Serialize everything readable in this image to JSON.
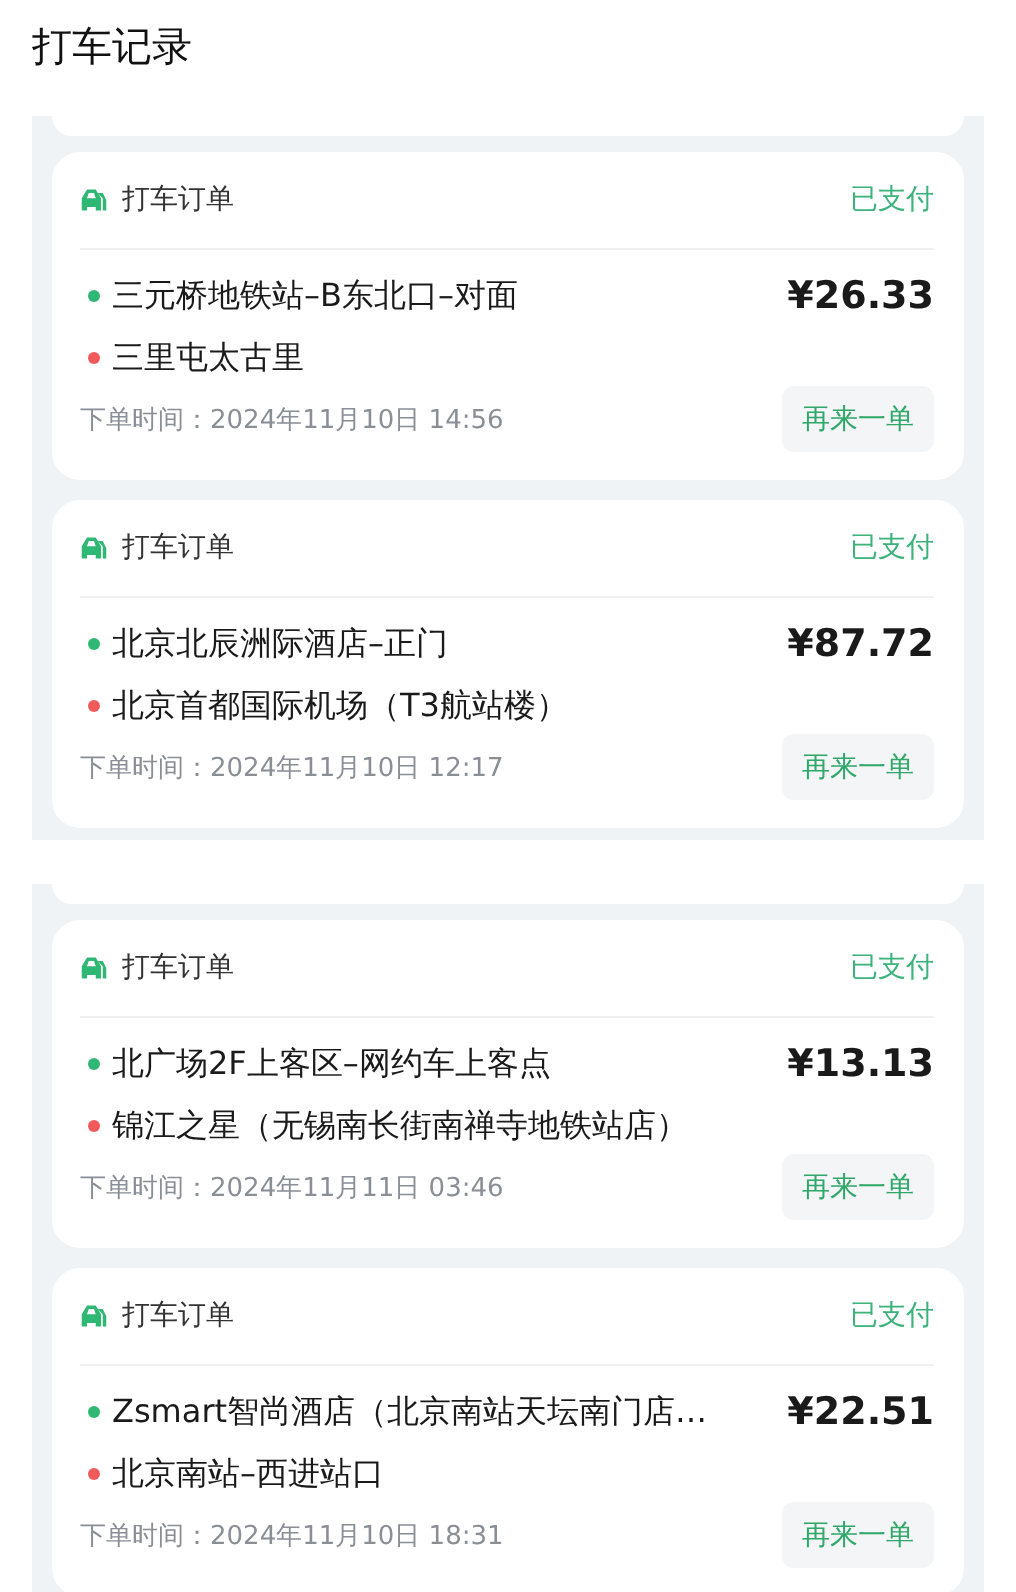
{
  "title": "打车记录",
  "sections": [
    {
      "orders": [
        {
          "type": "打车订单",
          "status": "已支付",
          "price": "¥26.33",
          "stops": [
            {
              "name": "三元桥地铁站–B东北口–对面",
              "color": "#2fb873"
            },
            {
              "name": "三里屯太古里",
              "color": "#f05a5a"
            }
          ],
          "time": "下单时间：2024年11月10日 14:56",
          "button": "再来一单"
        },
        {
          "type": "打车订单",
          "status": "已支付",
          "price": "¥87.72",
          "stops": [
            {
              "name": "北京北辰洲际酒店–正门",
              "color": "#2fb873"
            },
            {
              "name": "北京首都国际机场（T3航站楼）",
              "color": "#f05a5a"
            }
          ],
          "time": "下单时间：2024年11月10日 12:17",
          "button": "再来一单"
        }
      ]
    },
    {
      "orders": [
        {
          "type": "打车订单",
          "status": "已支付",
          "price": "¥13.13",
          "stops": [
            {
              "name": "北广场2F上客区–网约车上客点",
              "color": "#2fb873"
            },
            {
              "name": "锦江之星（无锡南长街南禅寺地铁站店）",
              "color": "#f05a5a"
            }
          ],
          "time": "下单时间：2024年11月11日 03:46",
          "button": "再来一单"
        },
        {
          "type": "打车订单",
          "status": "已支付",
          "price": "¥22.51",
          "stops": [
            {
              "name": "Zsmart智尚酒店（北京南站天坛南门店…",
              "color": "#2fb873"
            },
            {
              "name": "北京南站–西进站口",
              "color": "#f05a5a"
            }
          ],
          "time": "下单时间：2024年11月10日 18:31",
          "button": "再来一单"
        }
      ]
    }
  ]
}
